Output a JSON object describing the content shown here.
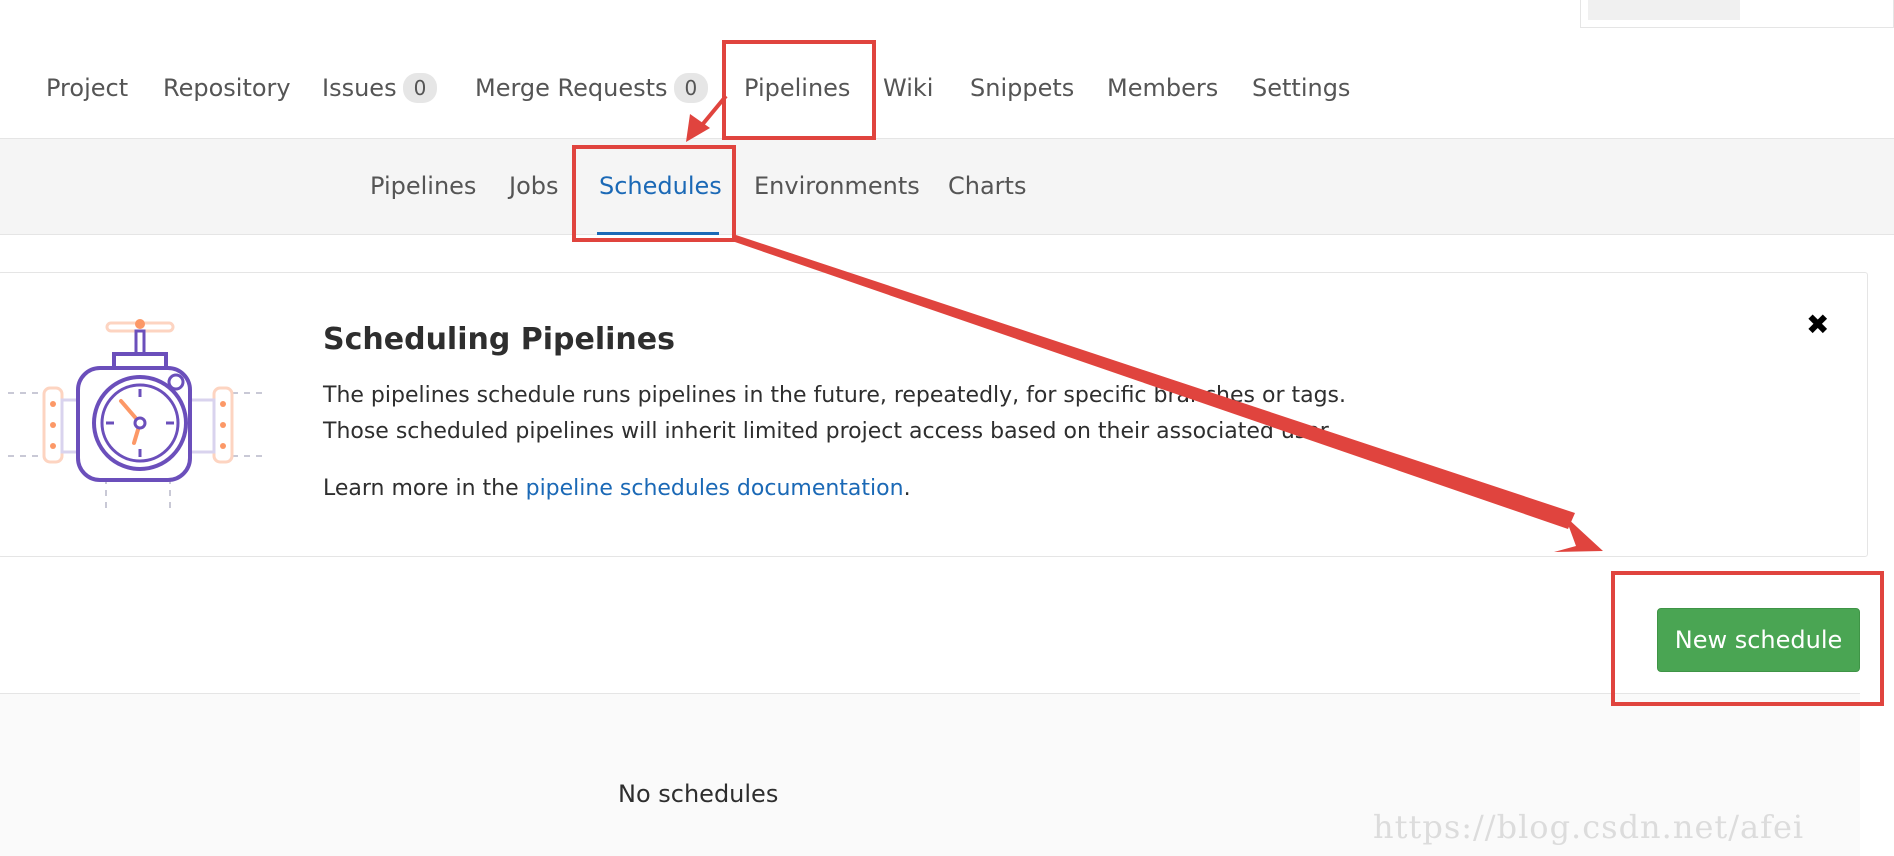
{
  "main_nav": {
    "items": [
      {
        "label": "Project"
      },
      {
        "label": "Repository"
      },
      {
        "label": "Issues",
        "badge": "0"
      },
      {
        "label": "Merge Requests",
        "badge": "0"
      },
      {
        "label": "Pipelines"
      },
      {
        "label": "Wiki"
      },
      {
        "label": "Snippets"
      },
      {
        "label": "Members"
      },
      {
        "label": "Settings"
      }
    ]
  },
  "sub_nav": {
    "items": [
      {
        "label": "Pipelines"
      },
      {
        "label": "Jobs"
      },
      {
        "label": "Schedules",
        "active": true
      },
      {
        "label": "Environments"
      },
      {
        "label": "Charts"
      }
    ]
  },
  "info_panel": {
    "title": "Scheduling Pipelines",
    "line1": "The pipelines schedule runs pipelines in the future, repeatedly, for specific branches or tags.",
    "line2": "Those scheduled pipelines will inherit limited project access based on their associated user.",
    "learn_prefix": "Learn more in the ",
    "learn_link": "pipeline schedules documentation",
    "learn_suffix": ".",
    "close_glyph": "✖",
    "illustration_icon": "pipeline-schedule-clock-illustration"
  },
  "actions": {
    "new_schedule_label": "New schedule"
  },
  "empty_state": {
    "text": "No schedules"
  },
  "watermark": "https://blog.csdn.net/afei",
  "colors": {
    "accent": "#1b69b6",
    "button_green": "#4aa553",
    "annotation_red": "#e0443e",
    "illustration_purple": "#6b4fbb",
    "illustration_orange": "#fc9867"
  }
}
